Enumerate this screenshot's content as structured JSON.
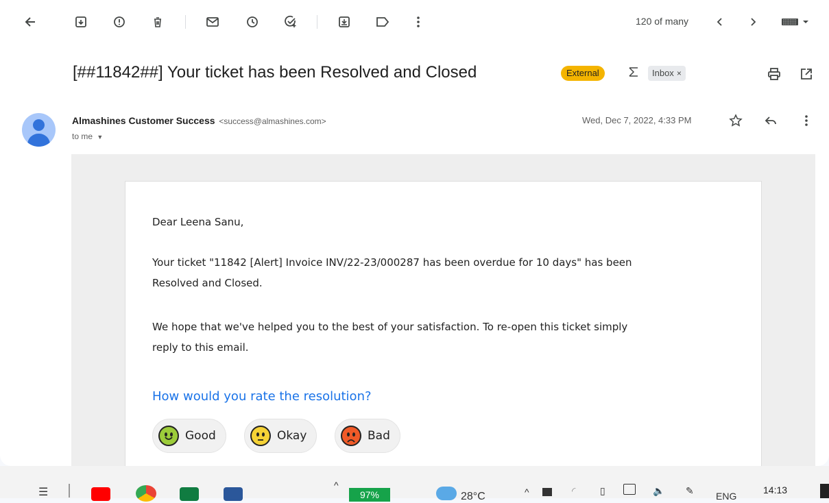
{
  "toolbar": {
    "count": "120 of many"
  },
  "email": {
    "subject": "[##11842##] Your ticket has been Resolved and Closed",
    "label_external": "External",
    "label_inbox": "Inbox",
    "label_inbox_remove": "×",
    "sender_name": "Almashines Customer Success",
    "sender_address": "<success@almashines.com>",
    "recipient": "to me",
    "date": "Wed, Dec 7, 2022, 4:33 PM"
  },
  "message": {
    "greeting": "Dear Leena Sanu,",
    "line1a": "Your ticket \"11842 [Alert] Invoice INV/22-23/000287 has been overdue for 10 days\" has been",
    "line1b": "Resolved and Closed.",
    "line2a": "We hope that we've helped you to the best of your satisfaction. To re-open this ticket simply",
    "line2b": "reply to this email.",
    "rating_question": "How would you rate the resolution?",
    "rating_options": [
      {
        "label": "Good",
        "color": "#9ccc3a"
      },
      {
        "label": "Okay",
        "color": "#f5d236"
      },
      {
        "label": "Bad",
        "color": "#f05a28"
      }
    ]
  },
  "taskbar": {
    "battery": "97%",
    "weather": "28°C",
    "language": "ENG",
    "time": "14:13"
  },
  "colors": {
    "accent_link": "#1a73e8",
    "external_chip": "#f4b400"
  }
}
